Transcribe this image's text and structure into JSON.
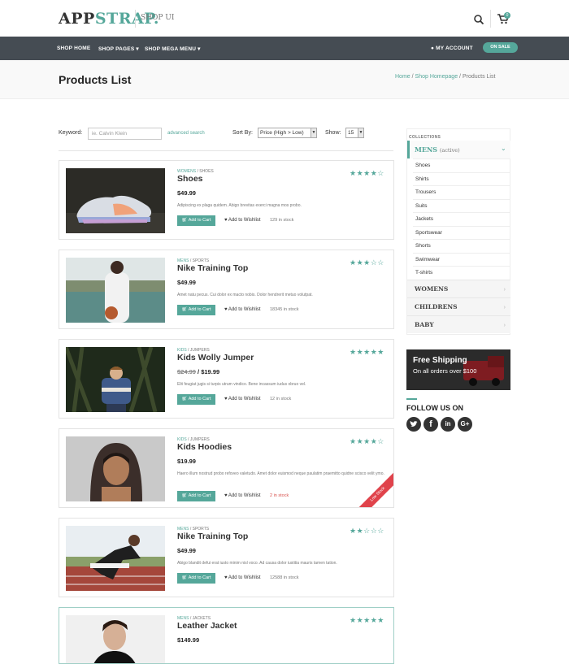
{
  "header": {
    "logo_main": "APP",
    "logo_accent": "STRAP.",
    "logo_sub": "SHOP UI",
    "cart_count": "0"
  },
  "nav": {
    "items": [
      "SHOP HOME",
      "SHOP PAGES ▾",
      "SHOP MEGA MENU ▾"
    ],
    "account": "MY ACCOUNT",
    "on_sale": "ON SALE"
  },
  "page": {
    "title": "Products List",
    "breadcrumbs": [
      "Home",
      "Shop Homepage",
      "Products List"
    ],
    "crumb_sep": "/"
  },
  "filters": {
    "keyword_label": "Keyword:",
    "keyword_placeholder": "ie. Calvin Klein",
    "advanced": "advanced search",
    "sort_label": "Sort By:",
    "sort_value": "Price (High > Low)",
    "show_label": "Show:",
    "show_value": "15"
  },
  "products": [
    {
      "cat1": "WOMENS",
      "cat2": "SHOES",
      "name": "Shoes",
      "price": "$49.99",
      "old_price": "",
      "desc": "Adipiscing ex plaga quidem. Abigo brevitas exerci magna mos probo.",
      "stock": "129 in stock",
      "rating": 4,
      "low_stock": false
    },
    {
      "cat1": "MENS",
      "cat2": "SPORTS",
      "name": "Nike Training Top",
      "price": "$49.99",
      "old_price": "",
      "desc": "Amet natu pecus. Cui dolor ex macto nobis. Dolor hendrerit metuo volutpat.",
      "stock": "18345 in stock",
      "rating": 3,
      "low_stock": false
    },
    {
      "cat1": "KIDS",
      "cat2": "JUMPERS",
      "name": "Kids Wolly Jumper",
      "price": "$19.99",
      "old_price": "$24.99",
      "desc": "Elit feugiat jugis si turpis utrum vindico. Bene incassum iudus obruo vel.",
      "stock": "12 in stock",
      "rating": 5,
      "low_stock": false
    },
    {
      "cat1": "KIDS",
      "cat2": "JUMPERS",
      "name": "Kids Hoodies",
      "price": "$19.99",
      "old_price": "",
      "desc": "Haero illum nostrud probo refoveo valetudo. Amet dolor euismod neque paulatim praemitto quidne scisco velit ymo.",
      "stock": "2 in stock",
      "rating": 4,
      "low_stock": true
    },
    {
      "cat1": "MENS",
      "cat2": "SPORTS",
      "name": "Nike Training Top",
      "price": "$49.99",
      "old_price": "",
      "desc": "Abigo blandit defui erat iusto minim nisl voco. Ad causa dolor iustitia mauris tamen tation.",
      "stock": "12588 in stock",
      "rating": 2,
      "low_stock": false
    },
    {
      "cat1": "MENS",
      "cat2": "JACKETS",
      "name": "Leather Jacket",
      "price": "$149.99",
      "old_price": "",
      "desc": "",
      "stock": "",
      "rating": 5,
      "low_stock": false
    }
  ],
  "labels": {
    "add_to_cart": "Add to Cart",
    "wishlist": "Add to Wishlist",
    "low_stock": "Low Stock"
  },
  "sidebar": {
    "collections_label": "COLLECTIONS",
    "active_name": "MENS",
    "active_tag": "(active)",
    "sub_items": [
      "Shoes",
      "Shirts",
      "Trousers",
      "Suits",
      "Jackets",
      "Sportswear",
      "Shorts",
      "Swimwear",
      "T-shirts"
    ],
    "categories": [
      "WOMENS",
      "CHILDRENS",
      "BABY"
    ],
    "banner_title": "Free Shipping",
    "banner_sub": "On all orders over $100",
    "follow": "FOLLOW US ON",
    "social": [
      "twitter-icon",
      "facebook-icon",
      "linkedin-icon",
      "google-plus-icon"
    ]
  },
  "colors": {
    "accent": "#55a79a",
    "nav": "#454c53",
    "ribbon": "#e0434b"
  }
}
